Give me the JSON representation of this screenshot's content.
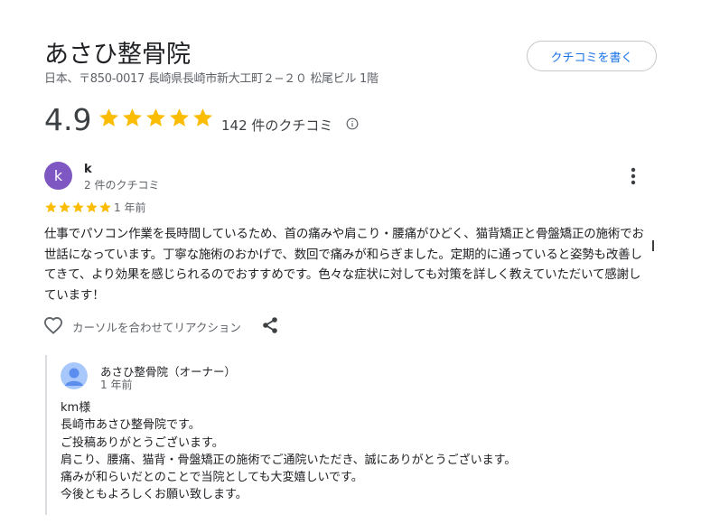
{
  "place": {
    "name": "あさひ整骨院",
    "address": "日本、〒850-0017 長崎県長崎市新大工町２−２０ 松尾ビル 1階"
  },
  "write_review_label": "クチコミを書く",
  "summary": {
    "rating": "4.9",
    "stars": 5,
    "review_count": "142 件のクチコミ"
  },
  "review": {
    "avatar_letter": "k",
    "author": "k",
    "author_reviews": "2 件のクチコミ",
    "stars": 5,
    "date": "1 年前",
    "text": "仕事でパソコン作業を長時間しているため、首の痛みや肩こり・腰痛がひどく、猫背矯正と骨盤矯正の施術でお世話になっています。丁寧な施術のおかげで、数回で痛みが和らぎました。定期的に通っていると姿勢も改善してきて、より効果を感じられるのでおすすめです。色々な症状に対しても対策を詳しく教えていただいて感謝しています！",
    "reaction_label": "カーソルを合わせてリアクション"
  },
  "owner_response": {
    "name": "あさひ整骨院（オーナー）",
    "date": "1 年前",
    "lines": [
      "km様",
      "長崎市あさひ整骨院です。",
      "ご投稿ありがとうございます。",
      "肩こり、腰痛、猫背・骨盤矯正の施術でご通院いただき、誠にありがとうございます。",
      "痛みが和らいだとのことで当院としても大変嬉しいです。",
      "今後ともよろしくお願い致します。"
    ]
  },
  "colors": {
    "star": "#fbbc04",
    "accent": "#1a73e8",
    "avatar": "#7e57c2"
  }
}
